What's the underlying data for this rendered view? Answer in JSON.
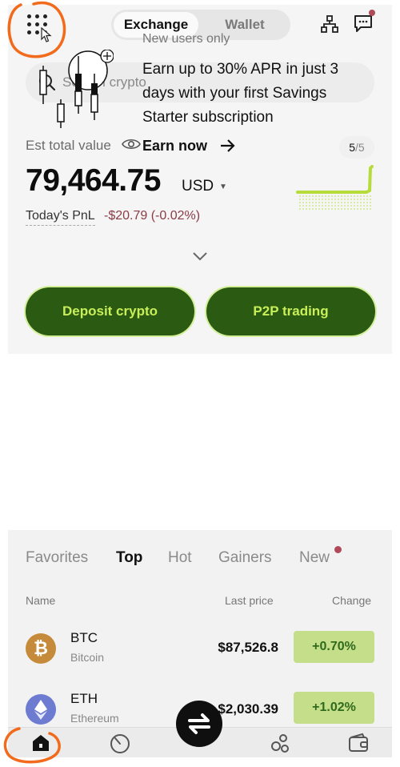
{
  "header": {
    "tabs": [
      {
        "label": "Exchange",
        "active": true
      },
      {
        "label": "Wallet",
        "active": false
      }
    ],
    "icons": [
      "apps-grid-icon",
      "network-tree-icon",
      "chat-icon"
    ]
  },
  "search": {
    "placeholder": "Search crypto"
  },
  "balance": {
    "label": "Est total value",
    "value": "79,464.75",
    "currency": "USD",
    "pnl_label": "Today's PnL",
    "pnl_value": "-$20.79 (-0.02%)"
  },
  "actions": {
    "deposit_label": "Deposit crypto",
    "p2p_label": "P2P trading"
  },
  "promo": {
    "tag": "New users only",
    "text": "Earn up to 30% APR in just 3 days with your first Savings Starter subscription",
    "cta": "Earn now",
    "page_current": "5",
    "page_total": "/5"
  },
  "market": {
    "tabs": [
      {
        "label": "Favorites",
        "active": false
      },
      {
        "label": "Top",
        "active": true
      },
      {
        "label": "Hot",
        "active": false
      },
      {
        "label": "Gainers",
        "active": false
      },
      {
        "label": "New",
        "active": false
      }
    ],
    "columns": {
      "name": "Name",
      "price": "Last price",
      "change": "Change"
    },
    "rows": [
      {
        "symbol": "BTC",
        "name": "Bitcoin",
        "price": "$87,526.8",
        "change": "+0.70%"
      },
      {
        "symbol": "ETH",
        "name": "Ethereum",
        "price": "$2,030.39",
        "change": "+1.02%"
      }
    ]
  },
  "nav": {
    "items": [
      "home-icon",
      "markets-icon",
      "trade-icon",
      "discover-icon",
      "wallet-icon"
    ]
  },
  "colors": {
    "accent_green": "#2b5a12",
    "lime": "#c8ef5a",
    "negative": "#8a3b46",
    "positive_bg": "#c5de8a",
    "annotation": "#f26a1b"
  }
}
